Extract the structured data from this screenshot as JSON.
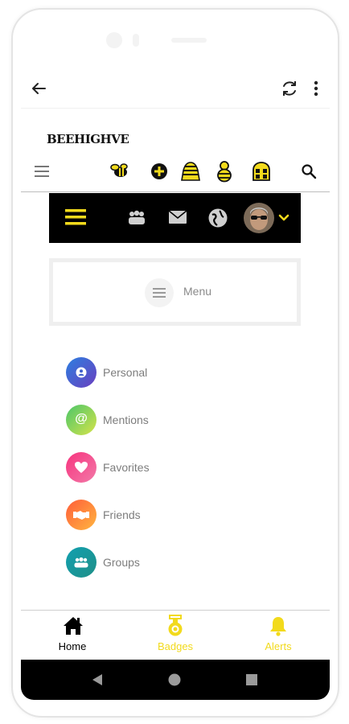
{
  "app": {
    "brand": "BEEHIGHVE"
  },
  "menu": {
    "label": "Menu"
  },
  "list": [
    {
      "label": "Personal",
      "icon": "person-icon",
      "color": "#3f6fd1"
    },
    {
      "label": "Mentions",
      "icon": "at-icon",
      "color": "#7ccf5a"
    },
    {
      "label": "Favorites",
      "icon": "heart-icon",
      "color": "#f0487f"
    },
    {
      "label": "Friends",
      "icon": "handshake-icon",
      "color": "#fb7f39"
    },
    {
      "label": "Groups",
      "icon": "group-icon",
      "color": "#18a3a9"
    }
  ],
  "bottom_nav": [
    {
      "label": "Home",
      "icon": "home-icon",
      "color": "#000000"
    },
    {
      "label": "Badges",
      "icon": "badge-icon",
      "color": "#f2da1c"
    },
    {
      "label": "Alerts",
      "icon": "bell-icon",
      "color": "#f2da1c"
    }
  ],
  "colors": {
    "accent": "#f2da1c",
    "bar": "#000000"
  }
}
